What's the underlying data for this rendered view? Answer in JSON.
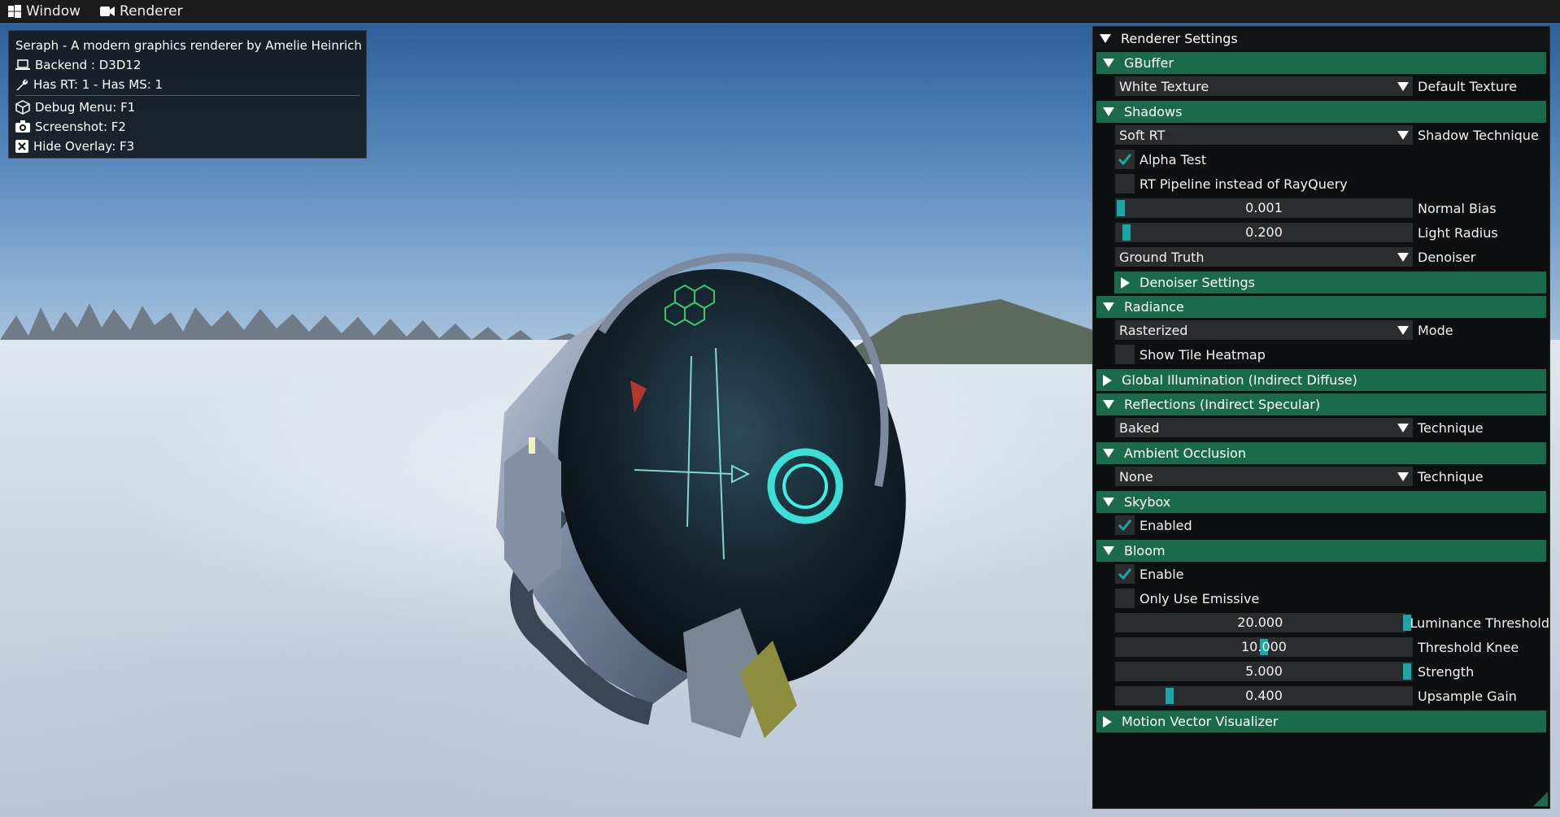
{
  "menubar": {
    "window_label": "Window",
    "renderer_label": "Renderer"
  },
  "overlay": {
    "title": "Seraph - A modern graphics renderer by Amelie Heinrich",
    "backend": "Backend : D3D12",
    "caps": "Has RT: 1 - Has MS: 1",
    "debug_menu": "Debug Menu: F1",
    "screenshot": "Screenshot: F2",
    "hide_overlay": "Hide Overlay: F3"
  },
  "panel": {
    "title": "Renderer Settings",
    "gbuffer": {
      "header": "GBuffer",
      "texture_value": "White Texture",
      "texture_label": "Default Texture"
    },
    "shadows": {
      "header": "Shadows",
      "technique_value": "Soft RT",
      "technique_label": "Shadow Technique",
      "alpha_test_label": "Alpha Test",
      "alpha_test_checked": true,
      "rt_pipeline_label": "RT Pipeline instead of RayQuery",
      "rt_pipeline_checked": false,
      "normal_bias_value": "0.001",
      "normal_bias_label": "Normal Bias",
      "normal_bias_fraction": 0.0,
      "light_radius_value": "0.200",
      "light_radius_label": "Light Radius",
      "light_radius_fraction": 0.02,
      "denoiser_value": "Ground Truth",
      "denoiser_label": "Denoiser",
      "denoiser_settings_header": "Denoiser Settings"
    },
    "radiance": {
      "header": "Radiance",
      "mode_value": "Rasterized",
      "mode_label": "Mode",
      "heatmap_label": "Show Tile Heatmap",
      "heatmap_checked": false
    },
    "gi": {
      "header": "Global Illumination (Indirect Diffuse)"
    },
    "reflections": {
      "header": "Reflections (Indirect Specular)",
      "technique_value": "Baked",
      "technique_label": "Technique"
    },
    "ao": {
      "header": "Ambient Occlusion",
      "technique_value": "None",
      "technique_label": "Technique"
    },
    "skybox": {
      "header": "Skybox",
      "enabled_label": "Enabled",
      "enabled_checked": true
    },
    "bloom": {
      "header": "Bloom",
      "enable_label": "Enable",
      "enable_checked": true,
      "emissive_label": "Only Use Emissive",
      "emissive_checked": false,
      "threshold_value": "20.000",
      "threshold_label": "Luminance Threshold",
      "threshold_fraction": 1.0,
      "knee_value": "10.000",
      "knee_label": "Threshold Knee",
      "knee_fraction": 0.5,
      "strength_value": "5.000",
      "strength_label": "Strength",
      "strength_fraction": 1.0,
      "gain_value": "0.400",
      "gain_label": "Upsample Gain",
      "gain_fraction": 0.17
    },
    "motion": {
      "header": "Motion Vector Visualizer"
    }
  },
  "colors": {
    "header_green": "#196b4b",
    "accent_teal": "#1aa6a6",
    "frame_bg": "#2b2c2e"
  }
}
